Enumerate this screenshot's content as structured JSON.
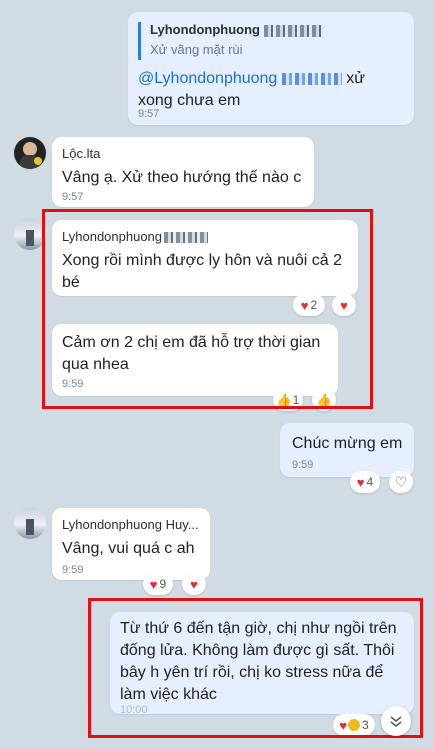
{
  "messages": {
    "m1": {
      "quote_sender": "Lyhondonphuong",
      "quote_text": "Xử vãng mặt rùi",
      "mention": "@Lyhondonphuong",
      "text_suffix": "xử",
      "text_line2": "xong chưa em",
      "time": "9:57"
    },
    "m2": {
      "sender": "Lộc.lta",
      "text": "Vâng ạ. Xử theo hướng thế nào c",
      "time": "9:57"
    },
    "m3": {
      "sender": "Lyhondonphuong",
      "text_line1": "Xong rồi mình được ly hôn và nuôi cả 2",
      "text_line2": "bé",
      "reaction_count": "2"
    },
    "m4": {
      "text_line1": "Cảm ơn 2 chị em đã hỗ trợ thời gian",
      "text_line2": "qua nhea",
      "time": "9:59",
      "reaction_count": "1"
    },
    "m5": {
      "text": "Chúc mừng em",
      "time": "9:59",
      "reaction_count": "4"
    },
    "m6": {
      "sender": "Lyhondonphuong Huy...",
      "text": "Vâng, vui quá c ah",
      "time": "9:59",
      "reaction_count": "9"
    },
    "m7": {
      "line1": "Từ thứ 6 đến tận giờ, chị như ngồi trên",
      "line2": "đống lửa. Không làm được gì sất. Thôi",
      "line3": "bây h yên trí rồi, chị ko stress nữa để",
      "line4": "làm việc khác",
      "time": "10:00",
      "reaction_count": "3"
    }
  },
  "icons": {
    "heart": "♥",
    "thumb": "👍",
    "heart_outline": "♡",
    "chevron_down": "⌄"
  },
  "colors": {
    "highlight_box": "#e01010",
    "outgoing": "#e5efff",
    "incoming": "#ffffff",
    "background": "#d1dbe3"
  }
}
